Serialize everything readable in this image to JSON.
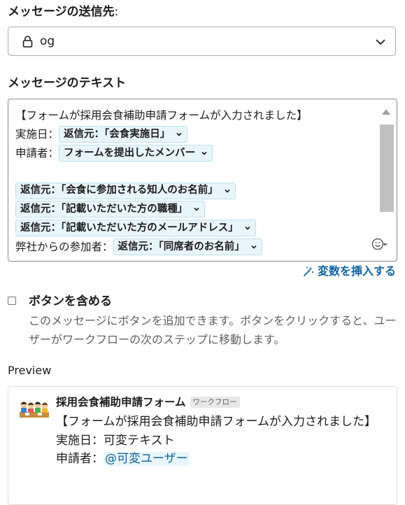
{
  "recipient": {
    "label": "メッセージの送信先",
    "colon": ":",
    "selected_value": "og",
    "icon": "lock-icon"
  },
  "message": {
    "label": "メッセージのテキスト",
    "line1": "【フォームが採用会食補助申請フォームが入力されました】",
    "date_label": "実施日：",
    "date_var": "返信元：「会食実施日」",
    "applicant_label": "申請者：",
    "applicant_var": "フォームを提出したメンバー",
    "var_acquaintance": "返信元：「会食に参加される知人のお名前」",
    "var_position": "返信元：「記載いただいた方の職種」",
    "var_email": "返信元：「記載いただいた方のメールアドレス」",
    "participants_label": "弊社からの参加者：",
    "participants_var": "返信元：「同席者のお名前」"
  },
  "insert_variable": {
    "label": "変数を挿入する"
  },
  "include_button": {
    "label": "ボタンを含める",
    "description": "このメッセージにボタンを追加できます。ボタンをクリックすると、ユーザーがワークフローの次のステップに移動します。",
    "checked": false
  },
  "preview": {
    "label": "Preview",
    "sender": "採用会食補助申請フォーム",
    "badge": "ワークフロー",
    "text_line1": "【フォームが採用会食補助申請フォームが入力されました】",
    "date_label": "実施日：",
    "date_value": "可変テキスト",
    "applicant_label": "申請者：",
    "applicant_value": "@可変ユーザー"
  },
  "colors": {
    "accent": "#1264a3",
    "pill_bg": "#e8f5fa",
    "pill_border": "#bfe0ef"
  }
}
